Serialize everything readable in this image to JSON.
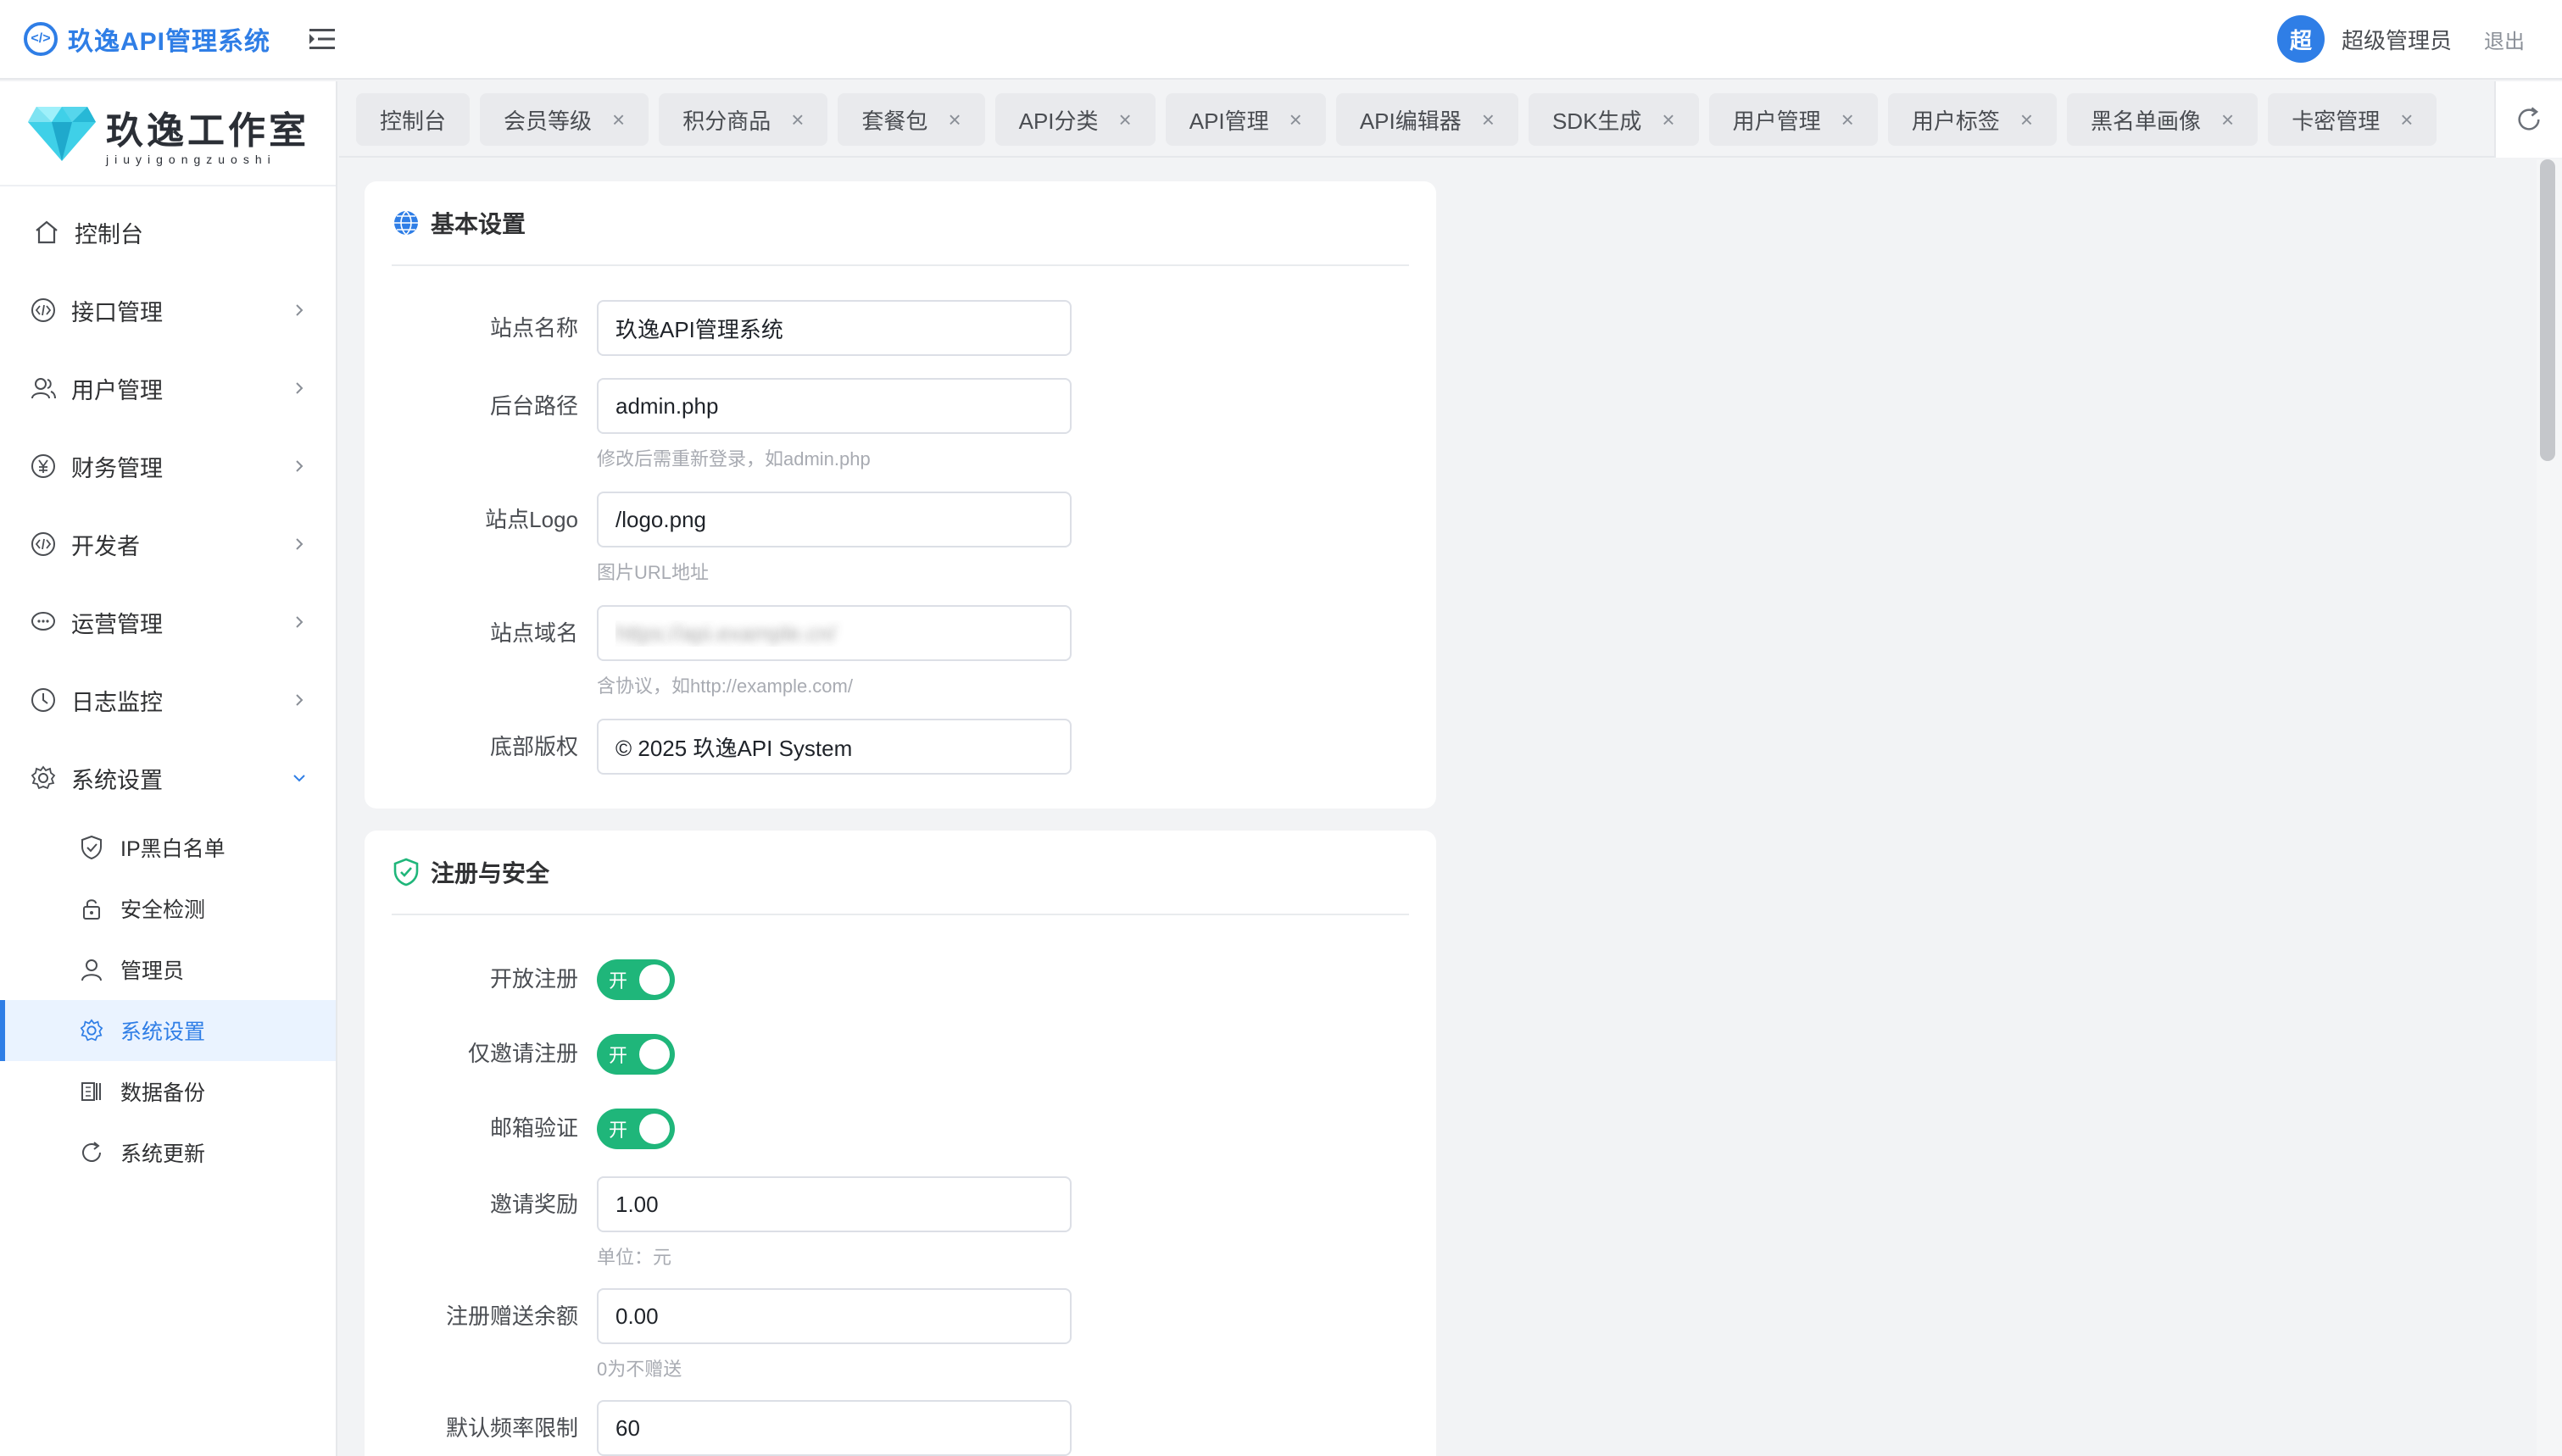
{
  "header": {
    "app_title": "玖逸API管理系统",
    "avatar_char": "超",
    "admin_name": "超级管理员",
    "logout_label": "退出"
  },
  "sidebar": {
    "logo_main": "玖逸工作室",
    "logo_sub": "jiuyigongzuoshi",
    "items": [
      {
        "label": "控制台",
        "icon": "home-icon"
      },
      {
        "label": "接口管理",
        "icon": "code-icon"
      },
      {
        "label": "用户管理",
        "icon": "users-icon"
      },
      {
        "label": "财务管理",
        "icon": "yen-icon"
      },
      {
        "label": "开发者",
        "icon": "code-icon"
      },
      {
        "label": "运营管理",
        "icon": "chat-icon"
      },
      {
        "label": "日志监控",
        "icon": "clock-icon"
      },
      {
        "label": "系统设置",
        "icon": "gear-icon"
      }
    ],
    "sub_items": [
      {
        "label": "IP黑白名单",
        "icon": "shield-check-icon"
      },
      {
        "label": "安全检测",
        "icon": "lock-icon"
      },
      {
        "label": "管理员",
        "icon": "user-icon"
      },
      {
        "label": "系统设置",
        "icon": "gear-icon"
      },
      {
        "label": "数据备份",
        "icon": "backup-icon"
      },
      {
        "label": "系统更新",
        "icon": "refresh-icon"
      }
    ]
  },
  "tabs": [
    {
      "label": "控制台"
    },
    {
      "label": "会员等级"
    },
    {
      "label": "积分商品"
    },
    {
      "label": "套餐包"
    },
    {
      "label": "API分类"
    },
    {
      "label": "API管理"
    },
    {
      "label": "API编辑器"
    },
    {
      "label": "SDK生成"
    },
    {
      "label": "用户管理"
    },
    {
      "label": "用户标签"
    },
    {
      "label": "黑名单画像"
    },
    {
      "label": "卡密管理"
    }
  ],
  "tab_close_symbol": "×",
  "basic": {
    "title": "基本设置",
    "site_name_label": "站点名称",
    "site_name_value": "玖逸API管理系统",
    "admin_path_label": "后台路径",
    "admin_path_value": "admin.php",
    "admin_path_hint": "修改后需重新登录，如admin.php",
    "logo_label": "站点Logo",
    "logo_value": "/logo.png",
    "logo_hint": "图片URL地址",
    "domain_label": "站点域名",
    "domain_value": "https://api.example.cn/",
    "domain_hint": "含协议，如http://example.com/",
    "copyright_label": "底部版权",
    "copyright_value": "© 2025 玖逸API System"
  },
  "security": {
    "title": "注册与安全",
    "open_reg_label": "开放注册",
    "invite_only_label": "仅邀请注册",
    "email_verify_label": "邮箱验证",
    "switch_on_text": "开",
    "invite_reward_label": "邀请奖励",
    "invite_reward_value": "1.00",
    "invite_reward_hint": "单位：元",
    "reg_bonus_label": "注册赠送余额",
    "reg_bonus_value": "0.00",
    "reg_bonus_hint": "0为不赠送",
    "rate_limit_label": "默认频率限制",
    "rate_limit_value": "60"
  },
  "colors": {
    "accent": "#2f7ee6",
    "switch_on": "#1fb67a"
  }
}
